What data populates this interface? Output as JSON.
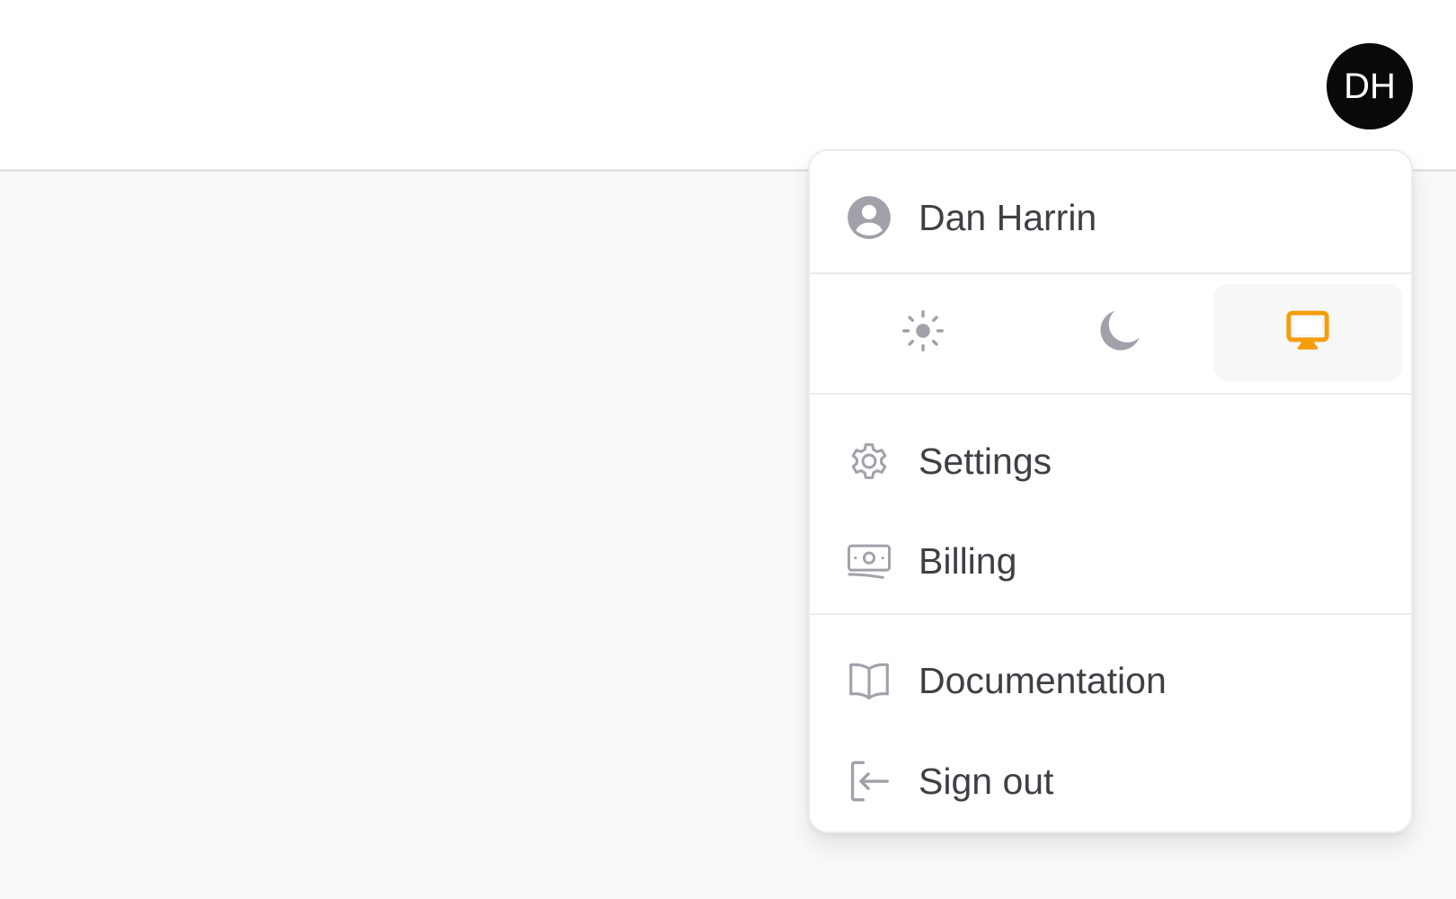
{
  "user": {
    "initials": "DH",
    "name": "Dan Harrin"
  },
  "theme": {
    "options": [
      {
        "name": "light",
        "icon": "sun-icon"
      },
      {
        "name": "dark",
        "icon": "moon-icon"
      },
      {
        "name": "system",
        "icon": "computer-desktop-icon"
      }
    ],
    "selected": "system",
    "active_color": "#f59e0b",
    "inactive_color": "#a1a1aa"
  },
  "menu": {
    "settings_label": "Settings",
    "billing_label": "Billing",
    "documentation_label": "Documentation",
    "sign_out_label": "Sign out"
  },
  "colors": {
    "icon_gray": "#a1a1aa",
    "text": "#3f3f46",
    "avatar_bg": "#09090b"
  }
}
